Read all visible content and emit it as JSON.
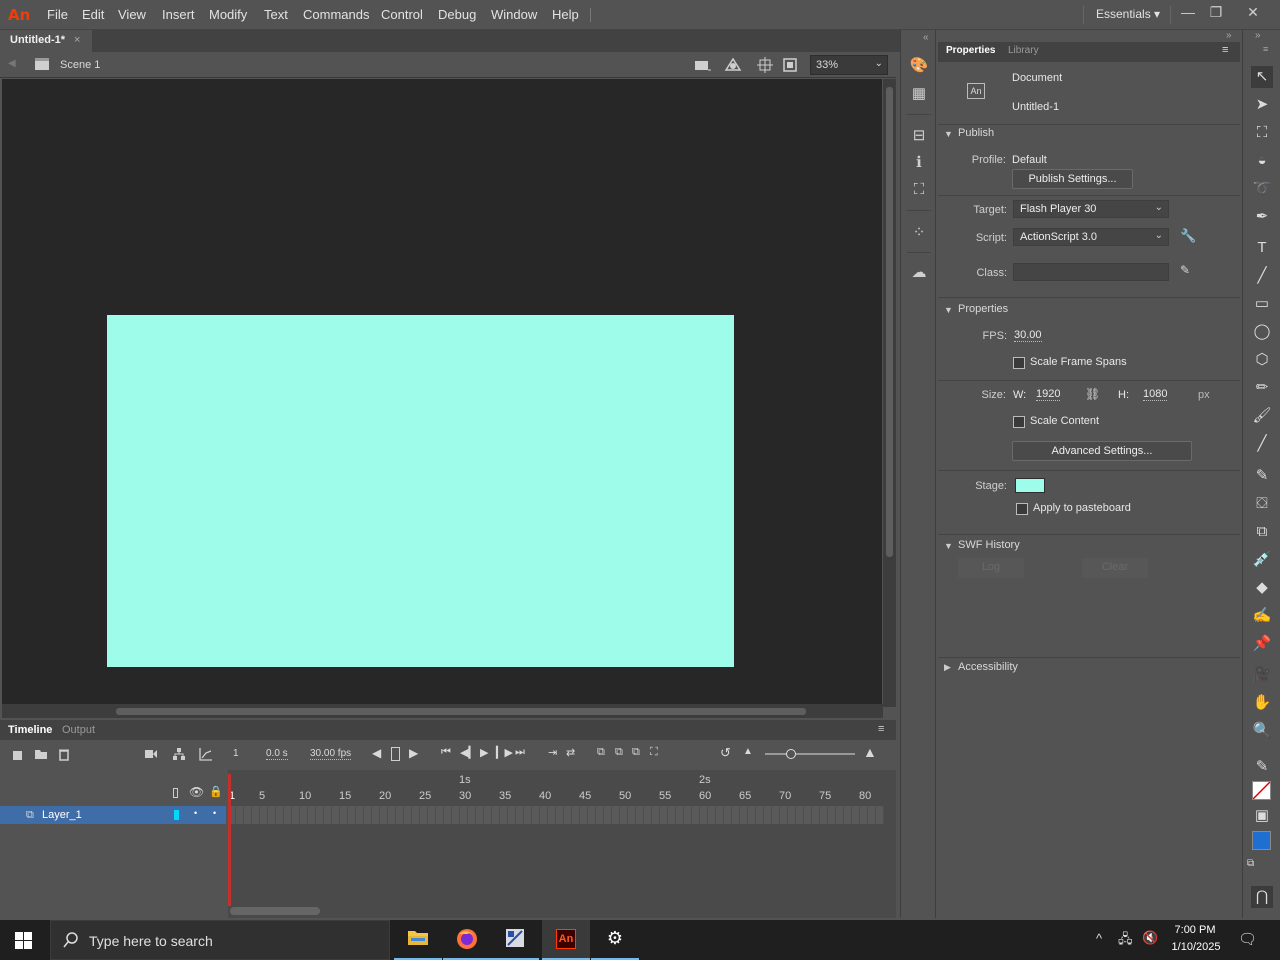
{
  "app": {
    "logo": "An",
    "menu": [
      "File",
      "Edit",
      "View",
      "Insert",
      "Modify",
      "Text",
      "Commands",
      "Control",
      "Debug",
      "Window",
      "Help"
    ],
    "workspace": "Essentials",
    "workspace_arrow": "▾"
  },
  "window_controls": {
    "minimize": "—",
    "restore": "❐",
    "close": "✕"
  },
  "document_tab": {
    "title": "Untitled-1*",
    "close": "×"
  },
  "scene_bar": {
    "scene": "Scene 1",
    "zoom": "33%"
  },
  "stage": {
    "color": "#9dfcea",
    "pasteboard_color": "#272727"
  },
  "timeline": {
    "tabs": [
      "Timeline",
      "Output"
    ],
    "current_frame": "1",
    "time": "0.0 s",
    "fps": "30.00 fps",
    "seconds_markers": [
      "1s",
      "2s"
    ],
    "frame_numbers": [
      "1",
      "5",
      "10",
      "15",
      "20",
      "25",
      "30",
      "35",
      "40",
      "45",
      "50",
      "55",
      "60",
      "65",
      "70",
      "75",
      "80"
    ],
    "layer": {
      "name": "Layer_1"
    }
  },
  "properties_panel": {
    "tabs": [
      "Properties",
      "Library"
    ],
    "doc_icon": "An",
    "doc_type": "Document",
    "doc_name": "Untitled-1",
    "publish": {
      "heading": "Publish",
      "profile_label": "Profile:",
      "profile_value": "Default",
      "publish_settings_btn": "Publish Settings...",
      "target_label": "Target:",
      "target_value": "Flash Player 30",
      "script_label": "Script:",
      "script_value": "ActionScript 3.0",
      "class_label": "Class:",
      "class_value": ""
    },
    "properties": {
      "heading": "Properties",
      "fps_label": "FPS:",
      "fps_value": "30.00",
      "scale_frame_spans": "Scale Frame Spans",
      "size_label": "Size:",
      "w_label": "W:",
      "w_value": "1920",
      "h_label": "H:",
      "h_value": "1080",
      "unit": "px",
      "scale_content": "Scale Content",
      "advanced_btn": "Advanced Settings...",
      "stage_label": "Stage:",
      "stage_color": "#9dfcea",
      "apply_pasteboard": "Apply to pasteboard"
    },
    "swf_history": {
      "heading": "SWF History",
      "log_btn": "Log",
      "clear_btn": "Clear"
    },
    "accessibility": {
      "heading": "Accessibility"
    }
  },
  "taskbar": {
    "search_placeholder": "Type here to search",
    "time": "7:00 PM",
    "date": "1/10/2025",
    "an_label": "An"
  },
  "colors": {
    "accent_layer": "#3f6da8",
    "playhead": "#c4302b",
    "fill_swatch": "#1e6fd0"
  }
}
